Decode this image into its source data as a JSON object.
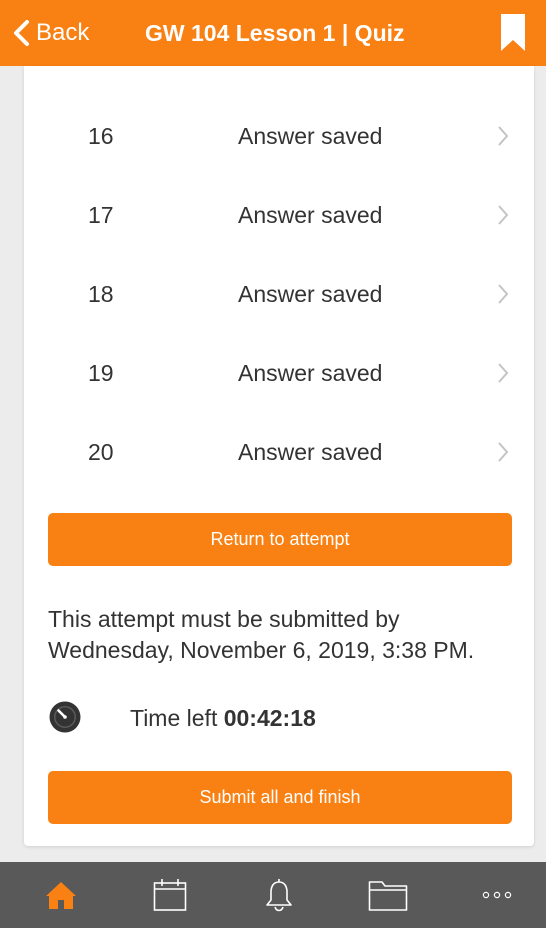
{
  "header": {
    "back_label": "Back",
    "title": "GW 104 Lesson 1 | Quiz"
  },
  "questions": [
    {
      "number": "16",
      "status": "Answer saved"
    },
    {
      "number": "17",
      "status": "Answer saved"
    },
    {
      "number": "18",
      "status": "Answer saved"
    },
    {
      "number": "19",
      "status": "Answer saved"
    },
    {
      "number": "20",
      "status": "Answer saved"
    }
  ],
  "return_label": "Return to attempt",
  "deadline": {
    "line1": "This attempt must be submitted by",
    "line2": "Wednesday, November 6, 2019, 3:38 PM."
  },
  "timer": {
    "label": "Time left",
    "value": "00:42:18"
  },
  "submit_label": "Submit all and finish",
  "nav": {
    "items": [
      "home-icon",
      "calendar-icon",
      "bell-icon",
      "folder-icon",
      "more-icon"
    ],
    "active": "home-icon"
  },
  "colors": {
    "accent": "#f98012",
    "nav_bg": "#595959",
    "nav_icon": "#ffffff"
  }
}
